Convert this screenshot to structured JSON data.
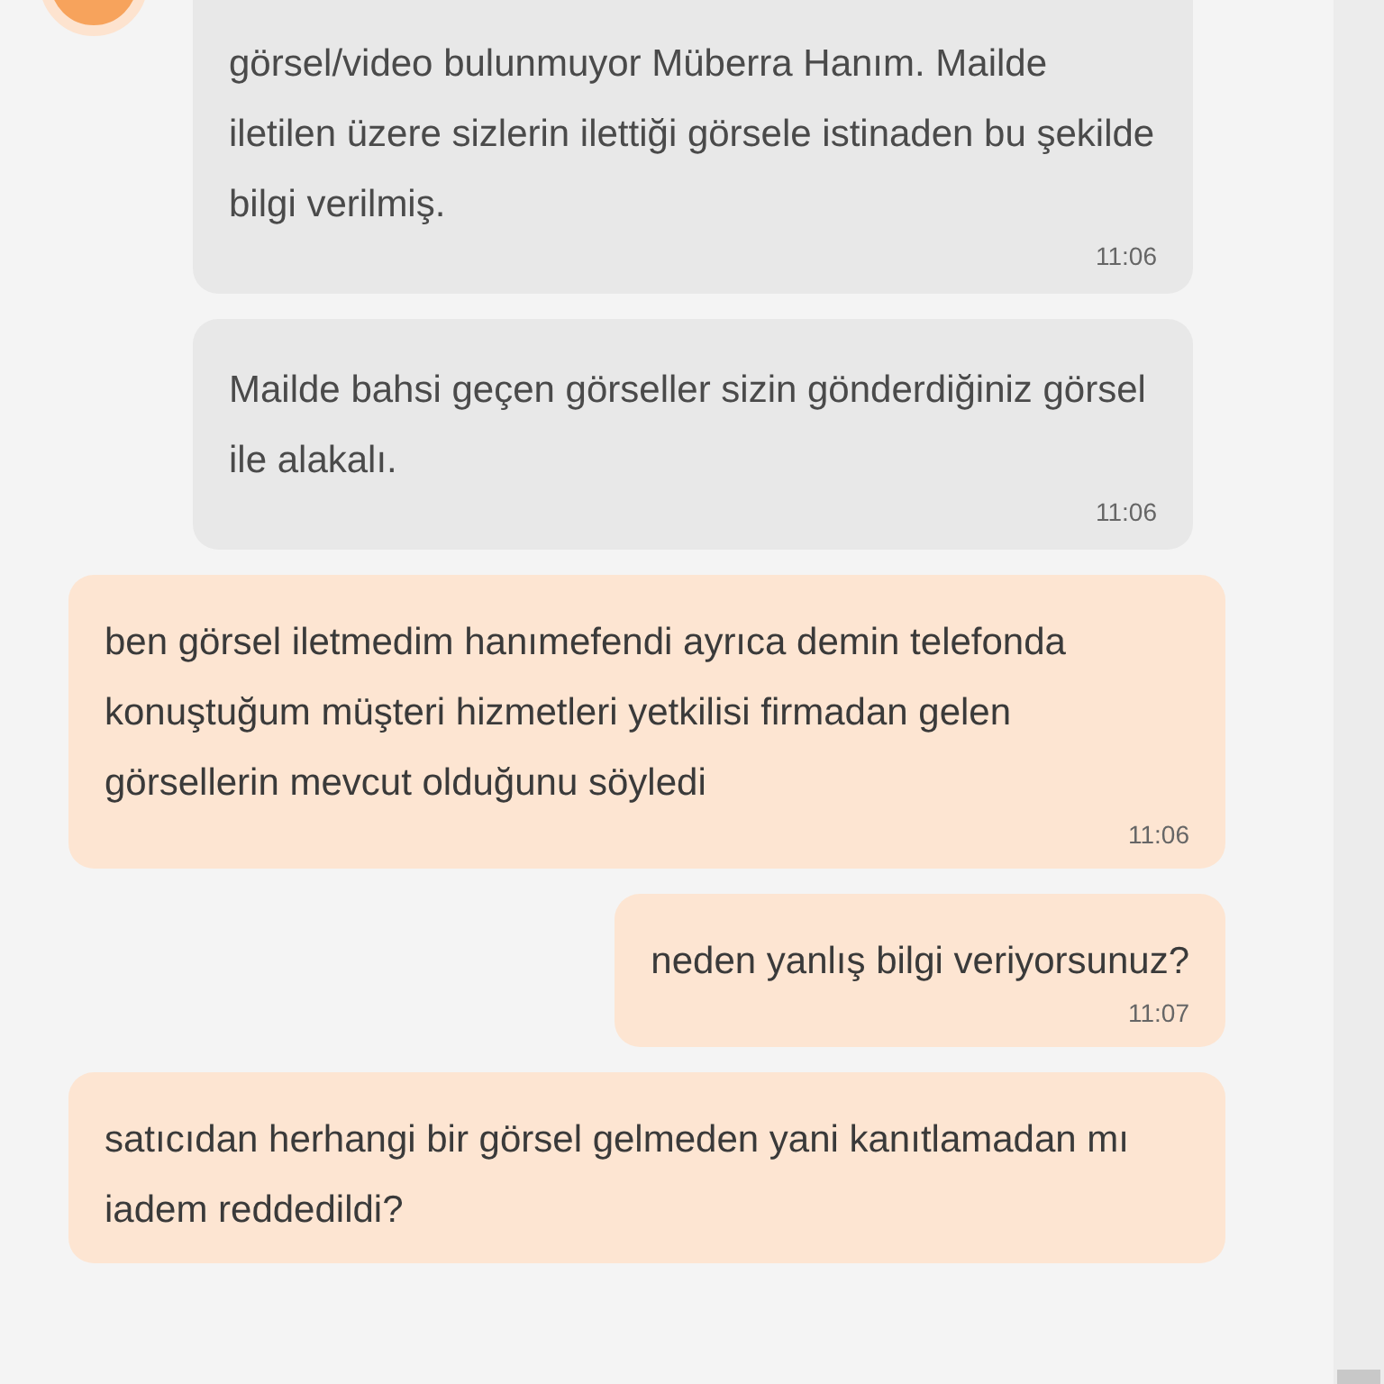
{
  "messages": [
    {
      "kind": "agent",
      "text": "görsel/video bulunmuyor Müberra Hanım. Mailde iletilen üzere sizlerin ilettiği görsele istinaden bu şekilde bilgi verilmiş.",
      "time": "11:06",
      "avatar": true
    },
    {
      "kind": "agent",
      "text": "Mailde bahsi geçen görseller sizin gönderdiğiniz görsel ile alakalı.",
      "time": "11:06",
      "avatar": false
    },
    {
      "kind": "customer",
      "text": "ben görsel iletmedim hanımefendi ayrıca demin telefonda konuştuğum müşteri hizmetleri yetkilisi firmadan gelen görsellerin mevcut olduğunu söyledi",
      "time": "11:06"
    },
    {
      "kind": "customer",
      "text": "neden yanlış bilgi veriyorsunuz?",
      "time": "11:07"
    },
    {
      "kind": "customer",
      "text": "satıcıdan herhangi bir görsel gelmeden yani kanıtlamadan mı iadem reddedildi?"
    }
  ]
}
